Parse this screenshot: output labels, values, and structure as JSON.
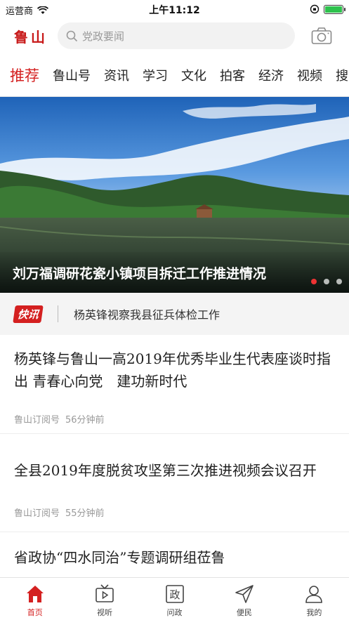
{
  "status_bar": {
    "carrier": "运营商",
    "time": "上午11:12"
  },
  "header": {
    "logo": "鲁山",
    "search_placeholder": "党政要闻"
  },
  "tabs": [
    "推荐",
    "鲁山号",
    "资讯",
    "学习",
    "文化",
    "拍客",
    "经济",
    "视频",
    "搜"
  ],
  "banner": {
    "caption": "刘万福调研花瓷小镇项目拆迁工作推进情况",
    "slide_count": 3,
    "active_slide": 1
  },
  "flash": {
    "badge": "快讯",
    "text": "杨英锋视察我县征兵体检工作"
  },
  "news": [
    {
      "title": "杨英锋与鲁山一高2019年优秀毕业生代表座谈时指出 青春心向党　建功新时代",
      "source": "鲁山订阅号",
      "time": "56分钟前"
    },
    {
      "title": "全县2019年度脱贫攻坚第三次推进视频会议召开",
      "source": "鲁山订阅号",
      "time": "55分钟前"
    },
    {
      "title": "省政协“四水同治”专题调研组莅鲁"
    }
  ],
  "bottom_nav": [
    {
      "label": "首页",
      "icon": "home-icon",
      "active": true
    },
    {
      "label": "视听",
      "icon": "tv-icon"
    },
    {
      "label": "问政",
      "icon": "politics-icon",
      "glyph": "政"
    },
    {
      "label": "便民",
      "icon": "paper-plane-icon"
    },
    {
      "label": "我的",
      "icon": "user-icon"
    }
  ],
  "colors": {
    "accent": "#d42020"
  }
}
